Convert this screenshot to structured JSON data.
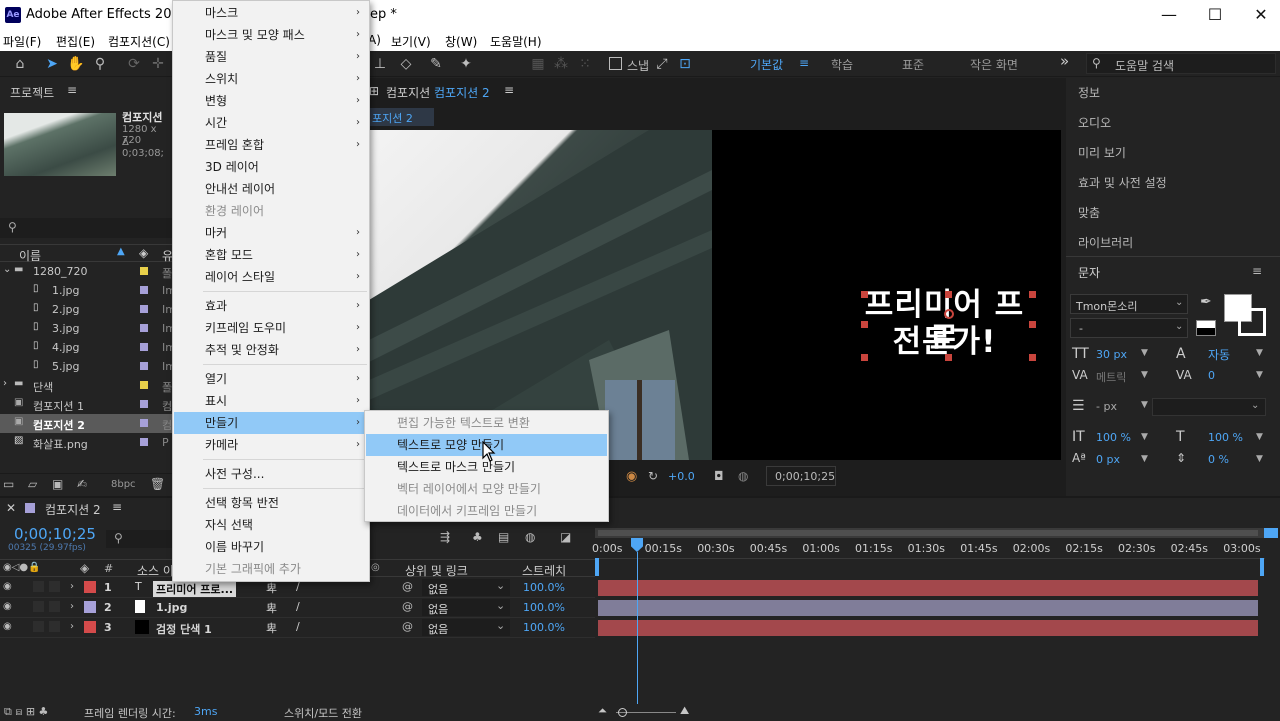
{
  "window": {
    "title": "Adobe After Effects 2022 -",
    "title_suffix": "ep *",
    "app_badge": "Ae",
    "min": "—",
    "max": "☐",
    "close": "✕"
  },
  "menubar": [
    "파일(F)",
    "편집(E)",
    "컴포지션(C)",
    "A)",
    "보기(V)",
    "창(W)",
    "도움말(H)"
  ],
  "toolbar": {
    "snap_label": "스냅",
    "workspaces": [
      "기본값",
      "학습",
      "표준",
      "작은 화면"
    ],
    "active_workspace": "기본값",
    "more": "»",
    "help_search_placeholder": "도움말 검색"
  },
  "project": {
    "title": "프로젝트",
    "preview_name": "컴포지션",
    "preview_size": "1280 x 720",
    "preview_duration": "Δ 0;03;08;",
    "search_placeholder": "",
    "col_name": "이름",
    "col_type": "유",
    "items": [
      {
        "name": "1280_720",
        "type": "폴",
        "color": "#e8d04a",
        "folder": true,
        "open": true
      },
      {
        "name": "1.jpg",
        "type": "Im",
        "color": "#a6a0d8",
        "folder": false
      },
      {
        "name": "2.jpg",
        "type": "Im",
        "color": "#a6a0d8",
        "folder": false
      },
      {
        "name": "3.jpg",
        "type": "Im",
        "color": "#a6a0d8",
        "folder": false
      },
      {
        "name": "4.jpg",
        "type": "Im",
        "color": "#a6a0d8",
        "folder": false
      },
      {
        "name": "5.jpg",
        "type": "Im",
        "color": "#a6a0d8",
        "folder": false
      },
      {
        "name": "단색",
        "type": "폴",
        "color": "#e8d04a",
        "folder": true,
        "open": false
      },
      {
        "name": "컴포지션 1",
        "type": "컴",
        "color": "#a6a0d8",
        "folder": false
      },
      {
        "name": "컴포지션 2",
        "type": "컴",
        "color": "#a6a0d8",
        "folder": false,
        "selected": true
      },
      {
        "name": "화살표.png",
        "type": "P",
        "color": "#a6a0d8",
        "folder": false
      }
    ],
    "bpc": "8bpc"
  },
  "viewer": {
    "tab_prefix": "컴포지션",
    "tab_name": "컴포지션 2",
    "sub_tab": "포지션 2",
    "text_line1": "프리미어 프로",
    "text_line2": "전문가!",
    "offset": "+0.0",
    "timecode": "0;00;10;25"
  },
  "right_panel": {
    "items": [
      "정보",
      "오디오",
      "미리 보기",
      "효과 및 사전 설정",
      "맞춤",
      "라이브러리"
    ],
    "text_title": "문자",
    "font": "Tmon몬소리",
    "style": "-",
    "size": "30 px",
    "leading": "자동",
    "kerning": "메트릭",
    "tracking": "0",
    "stroke": "- px",
    "vscale": "100 %",
    "hscale": "100 %",
    "baseline": "0 px",
    "tsume": "0 %"
  },
  "layer_menu": {
    "items": [
      {
        "label": "마스크",
        "sub": true,
        "dis": false
      },
      {
        "label": "마스크 및 모양 패스",
        "sub": true,
        "dis": false
      },
      {
        "label": "품질",
        "sub": true,
        "dis": false
      },
      {
        "label": "스위치",
        "sub": true,
        "dis": false
      },
      {
        "label": "변형",
        "sub": true,
        "dis": false
      },
      {
        "label": "시간",
        "sub": true,
        "dis": false
      },
      {
        "label": "프레임 혼합",
        "sub": true,
        "dis": false
      },
      {
        "label": "3D 레이어",
        "sub": false,
        "dis": false
      },
      {
        "label": "안내선 레이어",
        "sub": false,
        "dis": false
      },
      {
        "label": "환경 레이어",
        "sub": false,
        "dis": true
      },
      {
        "label": "마커",
        "sub": true,
        "dis": false
      },
      {
        "label": "혼합 모드",
        "sub": true,
        "dis": false
      },
      {
        "label": "레이어 스타일",
        "sub": true,
        "dis": false
      },
      {
        "label": "효과",
        "sub": true,
        "dis": false
      },
      {
        "label": "키프레임 도우미",
        "sub": true,
        "dis": false
      },
      {
        "label": "추적 및 안정화",
        "sub": true,
        "dis": false
      },
      {
        "label": "열기",
        "sub": true,
        "dis": false
      },
      {
        "label": "표시",
        "sub": true,
        "dis": false
      },
      {
        "label": "만들기",
        "sub": true,
        "dis": false,
        "hl": true
      },
      {
        "label": "카메라",
        "sub": true,
        "dis": false
      },
      {
        "label": "사전 구성...",
        "sub": false,
        "dis": false
      },
      {
        "label": "선택 항목 반전",
        "sub": false,
        "dis": false
      },
      {
        "label": "자식 선택",
        "sub": false,
        "dis": false
      },
      {
        "label": "이름 바꾸기",
        "sub": false,
        "dis": false
      },
      {
        "label": "기본 그래픽에 추가",
        "sub": false,
        "dis": true
      }
    ]
  },
  "create_submenu": {
    "items": [
      {
        "label": "편집 가능한 텍스트로 변환",
        "dis": true
      },
      {
        "label": "텍스트로 모양 만들기",
        "dis": false,
        "hl": true
      },
      {
        "label": "텍스트로 마스크 만들기",
        "dis": false
      },
      {
        "label": "벡터 레이어에서 모양 만들기",
        "dis": true
      },
      {
        "label": "데이터에서 키프레임 만들기",
        "dis": true
      }
    ]
  },
  "timeline": {
    "tab": "컴포지션 2",
    "timecode": "0;00;10;25",
    "fps": "00325 (29.97fps)",
    "col_num": "#",
    "col_source": "소스 이",
    "col_parent": "상위 및 링크",
    "col_stretch": "스트레치",
    "ticks": [
      "0:00s",
      "00:15s",
      "00:30s",
      "00:45s",
      "01:00s",
      "01:15s",
      "01:30s",
      "01:45s",
      "02:00s",
      "02:15s",
      "02:30s",
      "02:45s",
      "03:00s"
    ],
    "layers": [
      {
        "num": "1",
        "name": "프리미어 프로...",
        "type": "T",
        "color": "#d44b4b",
        "parent": "없음",
        "stretch": "100.0%",
        "bar": "#a3484c"
      },
      {
        "num": "2",
        "name": "1.jpg",
        "type": "img",
        "color": "#a6a0d8",
        "parent": "없음",
        "stretch": "100.0%",
        "bar": "#807d99"
      },
      {
        "num": "3",
        "name": "검정 단색 1",
        "type": "solid",
        "color": "#d44b4b",
        "parent": "없음",
        "stretch": "100.0%",
        "bar": "#a3484c"
      }
    ]
  },
  "statusbar": {
    "render_label": "프레임 렌더링 시간:",
    "render_value": "3ms",
    "toggle": "스위치/모드 전환"
  },
  "colors": {
    "accent": "#2d8ceb",
    "menu_highlight": "#91c9f7",
    "label_red": "#d44b4b",
    "label_lavender": "#a6a0d8",
    "label_yellow": "#e8d04a"
  }
}
